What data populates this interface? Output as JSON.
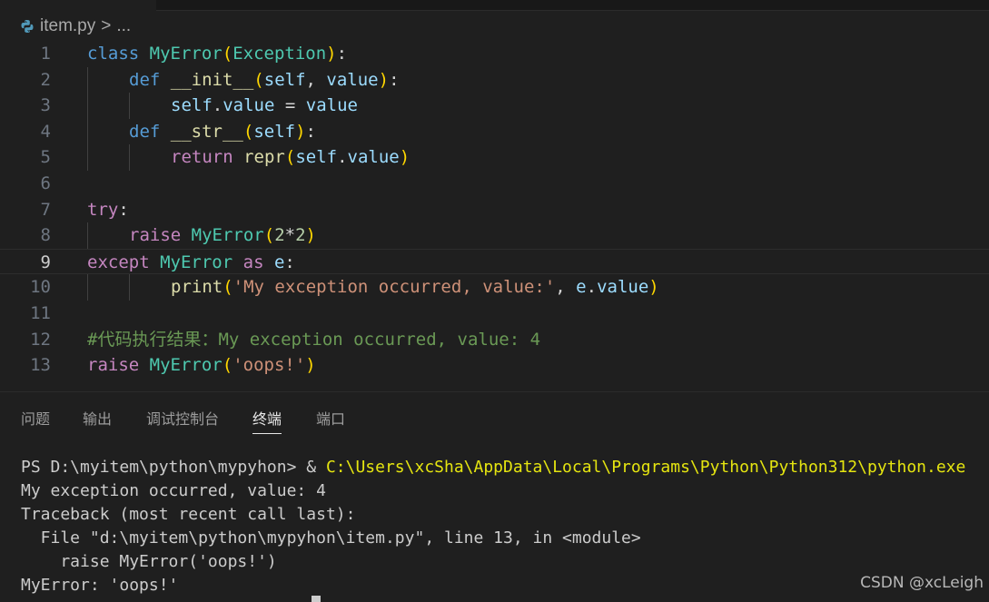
{
  "breadcrumb": {
    "file": "item.py",
    "separator": ">",
    "more": "..."
  },
  "editor": {
    "current_line": 9,
    "lines": [
      {
        "n": "1",
        "tokens": [
          [
            "def",
            "class"
          ],
          [
            "pl",
            " "
          ],
          [
            "cls",
            "MyError"
          ],
          [
            "p1",
            "("
          ],
          [
            "cls",
            "Exception"
          ],
          [
            "p1",
            ")"
          ],
          [
            "pl",
            ":"
          ]
        ]
      },
      {
        "n": "2",
        "indent": 1,
        "tokens": [
          [
            "def",
            "def"
          ],
          [
            "pl",
            " "
          ],
          [
            "fn",
            "__init__"
          ],
          [
            "p1",
            "("
          ],
          [
            "var",
            "self"
          ],
          [
            "pl",
            ", "
          ],
          [
            "var",
            "value"
          ],
          [
            "p1",
            ")"
          ],
          [
            "pl",
            ":"
          ]
        ]
      },
      {
        "n": "3",
        "indent": 2,
        "tokens": [
          [
            "var",
            "self"
          ],
          [
            "pl",
            "."
          ],
          [
            "var",
            "value"
          ],
          [
            "pl",
            " = "
          ],
          [
            "var",
            "value"
          ]
        ]
      },
      {
        "n": "4",
        "indent": 1,
        "tokens": [
          [
            "def",
            "def"
          ],
          [
            "pl",
            " "
          ],
          [
            "fn",
            "__str__"
          ],
          [
            "p1",
            "("
          ],
          [
            "var",
            "self"
          ],
          [
            "p1",
            ")"
          ],
          [
            "pl",
            ":"
          ]
        ]
      },
      {
        "n": "5",
        "indent": 2,
        "tokens": [
          [
            "kw",
            "return"
          ],
          [
            "pl",
            " "
          ],
          [
            "fn",
            "repr"
          ],
          [
            "p1",
            "("
          ],
          [
            "var",
            "self"
          ],
          [
            "pl",
            "."
          ],
          [
            "var",
            "value"
          ],
          [
            "p1",
            ")"
          ]
        ]
      },
      {
        "n": "6",
        "tokens": []
      },
      {
        "n": "7",
        "tokens": [
          [
            "kw",
            "try"
          ],
          [
            "pl",
            ":"
          ]
        ]
      },
      {
        "n": "8",
        "indent": 1,
        "tokens": [
          [
            "kw",
            "raise"
          ],
          [
            "pl",
            " "
          ],
          [
            "cls",
            "MyError"
          ],
          [
            "p1",
            "("
          ],
          [
            "num",
            "2"
          ],
          [
            "pl",
            "*"
          ],
          [
            "num",
            "2"
          ],
          [
            "p1",
            ")"
          ]
        ]
      },
      {
        "n": "9",
        "tokens": [
          [
            "kw",
            "except"
          ],
          [
            "pl",
            " "
          ],
          [
            "cls",
            "MyError"
          ],
          [
            "pl",
            " "
          ],
          [
            "kw",
            "as"
          ],
          [
            "pl",
            " "
          ],
          [
            "var",
            "e"
          ],
          [
            "pl",
            ":"
          ]
        ]
      },
      {
        "n": "10",
        "indent": 2,
        "tokens": [
          [
            "fn",
            "print"
          ],
          [
            "p1",
            "("
          ],
          [
            "str",
            "'My exception occurred, value:'"
          ],
          [
            "pl",
            ", "
          ],
          [
            "var",
            "e"
          ],
          [
            "pl",
            "."
          ],
          [
            "var",
            "value"
          ],
          [
            "p1",
            ")"
          ]
        ]
      },
      {
        "n": "11",
        "tokens": []
      },
      {
        "n": "12",
        "tokens": [
          [
            "cm",
            "#代码执行结果：My exception occurred, value: 4"
          ]
        ]
      },
      {
        "n": "13",
        "tokens": [
          [
            "kw",
            "raise"
          ],
          [
            "pl",
            " "
          ],
          [
            "cls",
            "MyError"
          ],
          [
            "p1",
            "("
          ],
          [
            "str",
            "'oops!'"
          ],
          [
            "p1",
            ")"
          ]
        ]
      }
    ]
  },
  "panel": {
    "tabs": [
      {
        "label": "问题",
        "active": false
      },
      {
        "label": "输出",
        "active": false
      },
      {
        "label": "调试控制台",
        "active": false
      },
      {
        "label": "终端",
        "active": true
      },
      {
        "label": "端口",
        "active": false
      }
    ]
  },
  "terminal": {
    "prompt": "PS D:\\myitem\\python\\mypyhon> & ",
    "command": "C:\\Users\\xcSha\\AppData\\Local\\Programs\\Python\\Python312\\python.exe",
    "output": [
      "My exception occurred, value: 4",
      "Traceback (most recent call last):",
      "  File \"d:\\myitem\\python\\mypyhon\\item.py\", line 13, in <module>",
      "    raise MyError('oops!')",
      "MyError: 'oops!'"
    ]
  },
  "watermark": "CSDN @xcLeigh",
  "colors": {
    "background": "#1f1f1f",
    "keyword": "#c586c0",
    "class": "#4ec9b0",
    "function": "#dcdcaa",
    "string": "#ce9178",
    "comment": "#6a9955",
    "terminal_command": "#e5e510"
  },
  "icons": {
    "file": "python-icon"
  }
}
